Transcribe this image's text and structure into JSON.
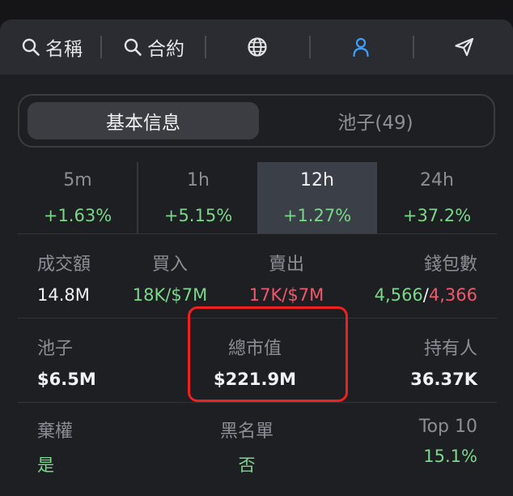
{
  "toolbar": {
    "search_name_label": "名稱",
    "search_contract_label": "合約"
  },
  "colors": {
    "user_icon": "#3aa0ff",
    "positive": "#7bd88a",
    "negative": "#f0586c",
    "highlight_box": "#ee2020"
  },
  "tabs": {
    "basic_info": "基本信息",
    "pools": "池子(49)"
  },
  "timeframes": [
    {
      "label": "5m",
      "change": "+1.63%"
    },
    {
      "label": "1h",
      "change": "+5.15%"
    },
    {
      "label": "12h",
      "change": "+1.27%"
    },
    {
      "label": "24h",
      "change": "+37.2%"
    }
  ],
  "stats_row1": {
    "volume_label": "成交額",
    "volume_value": "14.8M",
    "buys_label": "買入",
    "buys_value": "18K/$7M",
    "sells_label": "賣出",
    "sells_value": "17K/$7M",
    "wallets_label": "錢包數",
    "wallets_buy": "4,566",
    "wallets_sep": "/",
    "wallets_sell": "4,366"
  },
  "stats_row2": {
    "pool_label": "池子",
    "pool_value": "$6.5M",
    "mcap_label": "總市值",
    "mcap_value": "$221.9M",
    "holders_label": "持有人",
    "holders_value": "36.37K"
  },
  "stats_row3": {
    "renounced_label": "棄權",
    "renounced_value": "是",
    "blacklist_label": "黑名單",
    "blacklist_value": "否",
    "top10_label": "Top 10",
    "top10_value": "15.1%"
  }
}
